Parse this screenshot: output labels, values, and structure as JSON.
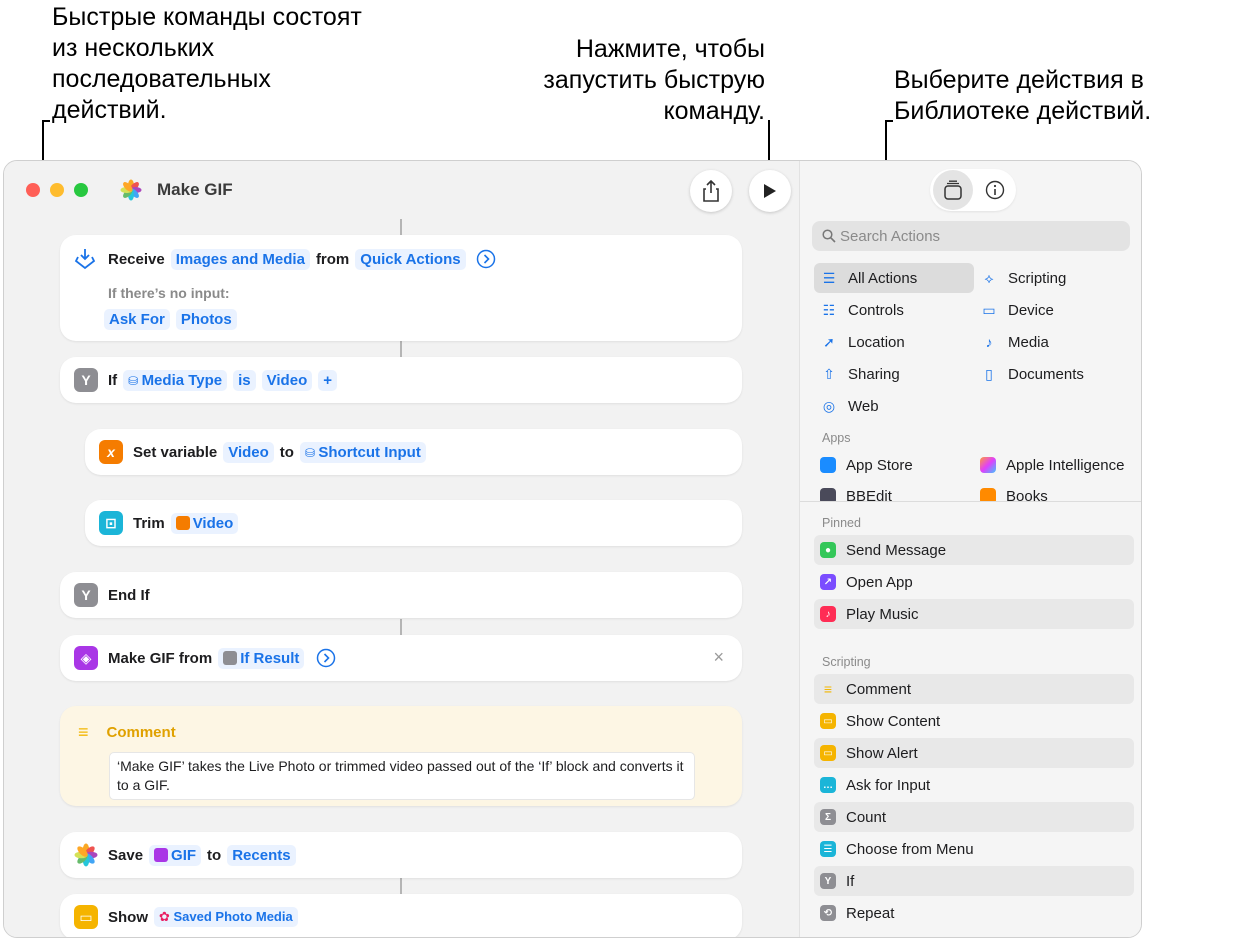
{
  "callouts": {
    "left": "Быстрые команды состоят из нескольких последовательных действий.",
    "middle": "Нажмите, чтобы запустить быструю команду.",
    "right": "Выберите действия в Библиотеке действий."
  },
  "window": {
    "title": "Make GIF"
  },
  "editor": {
    "receive": {
      "label": "Receive",
      "type": "Images and Media",
      "from": "from",
      "source": "Quick Actions",
      "no_input_label": "If there’s no input:",
      "ask": "Ask For",
      "photos": "Photos"
    },
    "if_block": {
      "label": "If",
      "var": "Media Type",
      "is": "is",
      "value": "Video",
      "plus": "+"
    },
    "set_var": {
      "label": "Set variable",
      "name": "Video",
      "to": "to",
      "value": "Shortcut Input"
    },
    "trim": {
      "label": "Trim",
      "value": "Video"
    },
    "end_if": {
      "label": "End If"
    },
    "make_gif": {
      "label": "Make GIF from",
      "value": "If Result",
      "close": "×"
    },
    "comment": {
      "title": "Comment",
      "text": "‘Make GIF’ takes the Live Photo or trimmed video passed out of the ‘If’ block and converts it to a GIF."
    },
    "save": {
      "label": "Save",
      "value": "GIF",
      "to": "to",
      "dest": "Recents"
    },
    "show": {
      "label": "Show",
      "value": "Saved Photo Media"
    }
  },
  "sidebar": {
    "search_placeholder": "Search Actions",
    "categories": [
      {
        "label": "All Actions",
        "icon": "list-icon"
      },
      {
        "label": "Scripting",
        "icon": "scripting-icon"
      },
      {
        "label": "Controls",
        "icon": "toggle-icon"
      },
      {
        "label": "Device",
        "icon": "display-icon"
      },
      {
        "label": "Location",
        "icon": "location-arrow-icon"
      },
      {
        "label": "Media",
        "icon": "music-note-icon"
      },
      {
        "label": "Sharing",
        "icon": "share-icon"
      },
      {
        "label": "Documents",
        "icon": "document-icon"
      },
      {
        "label": "Web",
        "icon": "compass-icon"
      }
    ],
    "apps_header": "Apps",
    "apps": [
      "App Store",
      "Apple Intelligence",
      "BBEdit",
      "Books"
    ],
    "pinned_header": "Pinned",
    "pinned": [
      "Send Message",
      "Open App",
      "Play Music"
    ],
    "scripting_header": "Scripting",
    "scripting": [
      "Comment",
      "Show Content",
      "Show Alert",
      "Ask for Input",
      "Count",
      "Choose from Menu",
      "If",
      "Repeat"
    ]
  }
}
